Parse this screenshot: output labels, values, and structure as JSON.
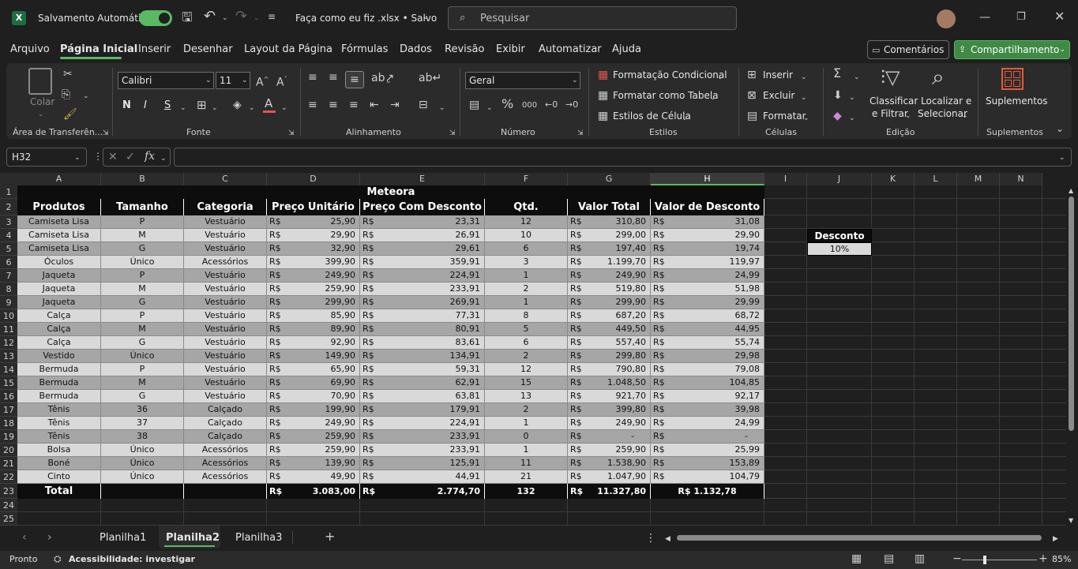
{
  "titlebar": {
    "autosave_label": "Salvamento Automático",
    "filename": "Faça como eu fiz .xlsx • Salvo",
    "search_placeholder": "Pesquisar"
  },
  "menu": {
    "items": [
      "Arquivo",
      "Página Inicial",
      "Inserir",
      "Desenhar",
      "Layout da Página",
      "Fórmulas",
      "Dados",
      "Revisão",
      "Exibir",
      "Automatizar",
      "Ajuda"
    ],
    "comments": "Comentários",
    "share": "Compartilhamento"
  },
  "ribbon": {
    "paste": "Colar",
    "clipboard": "Área de Transferên...",
    "font_name": "Calibri",
    "font_size": "11",
    "bold": "N",
    "italic": "I",
    "underline": "S",
    "font_group": "Fonte",
    "alignment_group": "Alinhamento",
    "number_format": "Geral",
    "number_group": "Número",
    "cond_format": "Formatação Condicional",
    "format_table": "Formatar como Tabela",
    "cell_styles": "Estilos de Célula",
    "styles_group": "Estilos",
    "insert": "Inserir",
    "delete": "Excluir",
    "format": "Formatar",
    "cells_group": "Células",
    "sort_l1": "Classificar",
    "sort_l2": "e Filtrar",
    "find_l1": "Localizar e",
    "find_l2": "Selecionar",
    "editing_group": "Edição",
    "addins": "Suplementos",
    "addins_group": "Suplementos"
  },
  "formula_bar": {
    "name_box": "H32",
    "formula": ""
  },
  "grid": {
    "columns": [
      "A",
      "B",
      "C",
      "D",
      "E",
      "F",
      "G",
      "H",
      "I",
      "J",
      "K",
      "L",
      "M",
      "N"
    ],
    "rows": [
      "1",
      "2",
      "3",
      "4",
      "5",
      "6",
      "7",
      "8",
      "9",
      "10",
      "11",
      "12",
      "13",
      "14",
      "15",
      "16",
      "17",
      "18",
      "19",
      "20",
      "21",
      "22",
      "23",
      "24",
      "25"
    ],
    "table_title": "Meteora",
    "headers": [
      "Produtos",
      "Tamanho",
      "Categoria",
      "Preço Unitário",
      "Preço Com Desconto",
      "Qtd.",
      "Valor Total",
      "Valor de Desconto"
    ],
    "currency": "R$",
    "data": [
      [
        "Camiseta Lisa",
        "P",
        "Vestuário",
        "25,90",
        "23,31",
        "12",
        "310,80",
        "31,08"
      ],
      [
        "Camiseta Lisa",
        "M",
        "Vestuário",
        "29,90",
        "26,91",
        "10",
        "299,00",
        "29,90"
      ],
      [
        "Camiseta Lisa",
        "G",
        "Vestuário",
        "32,90",
        "29,61",
        "6",
        "197,40",
        "19,74"
      ],
      [
        "Óculos",
        "Único",
        "Acessórios",
        "399,90",
        "359,91",
        "3",
        "1.199,70",
        "119,97"
      ],
      [
        "Jaqueta",
        "P",
        "Vestuário",
        "249,90",
        "224,91",
        "1",
        "249,90",
        "24,99"
      ],
      [
        "Jaqueta",
        "M",
        "Vestuário",
        "259,90",
        "233,91",
        "2",
        "519,80",
        "51,98"
      ],
      [
        "Jaqueta",
        "G",
        "Vestuário",
        "299,90",
        "269,91",
        "1",
        "299,90",
        "29,99"
      ],
      [
        "Calça",
        "P",
        "Vestuário",
        "85,90",
        "77,31",
        "8",
        "687,20",
        "68,72"
      ],
      [
        "Calça",
        "M",
        "Vestuário",
        "89,90",
        "80,91",
        "5",
        "449,50",
        "44,95"
      ],
      [
        "Calça",
        "G",
        "Vestuário",
        "92,90",
        "83,61",
        "6",
        "557,40",
        "55,74"
      ],
      [
        "Vestido",
        "Único",
        "Vestuário",
        "149,90",
        "134,91",
        "2",
        "299,80",
        "29,98"
      ],
      [
        "Bermuda",
        "P",
        "Vestuário",
        "65,90",
        "59,31",
        "12",
        "790,80",
        "79,08"
      ],
      [
        "Bermuda",
        "M",
        "Vestuário",
        "69,90",
        "62,91",
        "15",
        "1.048,50",
        "104,85"
      ],
      [
        "Bermuda",
        "G",
        "Vestuário",
        "70,90",
        "63,81",
        "13",
        "921,70",
        "92,17"
      ],
      [
        "Tênis",
        "36",
        "Calçado",
        "199,90",
        "179,91",
        "2",
        "399,80",
        "39,98"
      ],
      [
        "Tênis",
        "37",
        "Calçado",
        "249,90",
        "224,91",
        "1",
        "249,90",
        "24,99"
      ],
      [
        "Tênis",
        "38",
        "Calçado",
        "259,90",
        "233,91",
        "0",
        "-",
        "-"
      ],
      [
        "Bolsa",
        "Único",
        "Acessórios",
        "259,90",
        "233,91",
        "1",
        "259,90",
        "25,99"
      ],
      [
        "Boné",
        "Único",
        "Acessórios",
        "139,90",
        "125,91",
        "11",
        "1.538,90",
        "153,89"
      ],
      [
        "Cinto",
        "Único",
        "Acessórios",
        "49,90",
        "44,91",
        "21",
        "1.047,90",
        "104,79"
      ]
    ],
    "total": {
      "label": "Total",
      "unit_price": "3.083,00",
      "discount_price": "2.774,70",
      "qty": "132",
      "total_value": "11.327,80",
      "discount_value": "R$ 1.132,78"
    },
    "discount_box": {
      "label": "Desconto",
      "value": "10%"
    }
  },
  "sheets": {
    "tabs": [
      "Planilha1",
      "Planilha2",
      "Planilha3"
    ],
    "active": "Planilha2"
  },
  "status": {
    "ready": "Pronto",
    "accessibility": "Acessibilidade: investigar",
    "zoom": "85%"
  },
  "colors": {
    "accent": "#5ab963",
    "row_dark": "#a6a6a6",
    "row_light": "#d9d9d9"
  }
}
